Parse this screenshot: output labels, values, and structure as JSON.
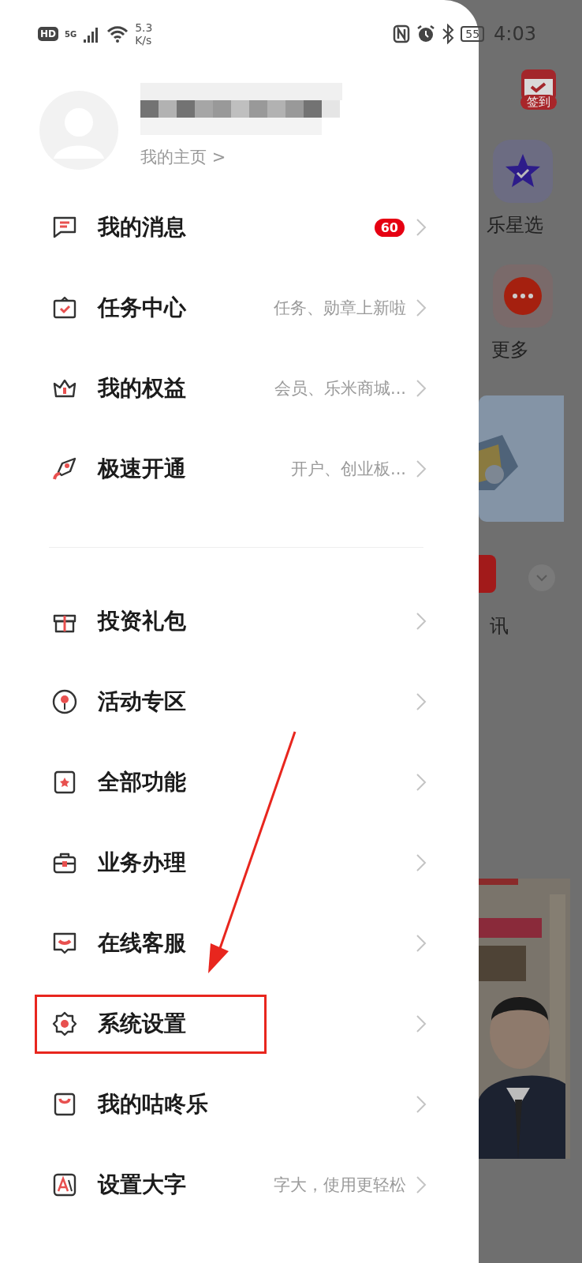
{
  "status_bar": {
    "hd": "HD",
    "network": "5G",
    "speed": "5.3 K/s",
    "battery": "55",
    "time": "4:03"
  },
  "profile": {
    "home_link": "我的主页 >"
  },
  "menu_groups": [
    [
      {
        "label": "我的消息",
        "badge": "60",
        "highlighted": false
      },
      {
        "label": "任务中心",
        "subtitle": "任务、勋章上新啦",
        "highlighted": false
      },
      {
        "label": "我的权益",
        "subtitle": "会员、乐米商城...",
        "highlighted": false
      },
      {
        "label": "极速开通",
        "subtitle": "开户、创业板...",
        "highlighted": false
      }
    ],
    [
      {
        "label": "投资礼包",
        "highlighted": false
      },
      {
        "label": "活动专区",
        "highlighted": false
      },
      {
        "label": "全部功能",
        "highlighted": false
      },
      {
        "label": "业务办理",
        "highlighted": false
      },
      {
        "label": "在线客服",
        "highlighted": false
      },
      {
        "label": "系统设置",
        "highlighted": true
      },
      {
        "label": "我的咕咚乐",
        "highlighted": false
      },
      {
        "label": "设置大字",
        "subtitle": "字大，使用更轻松",
        "highlighted": false
      }
    ]
  ],
  "background": {
    "checkin": "签到",
    "shortcuts": [
      {
        "label": "乐星选"
      },
      {
        "label": "更多"
      }
    ],
    "news_label": "讯"
  }
}
